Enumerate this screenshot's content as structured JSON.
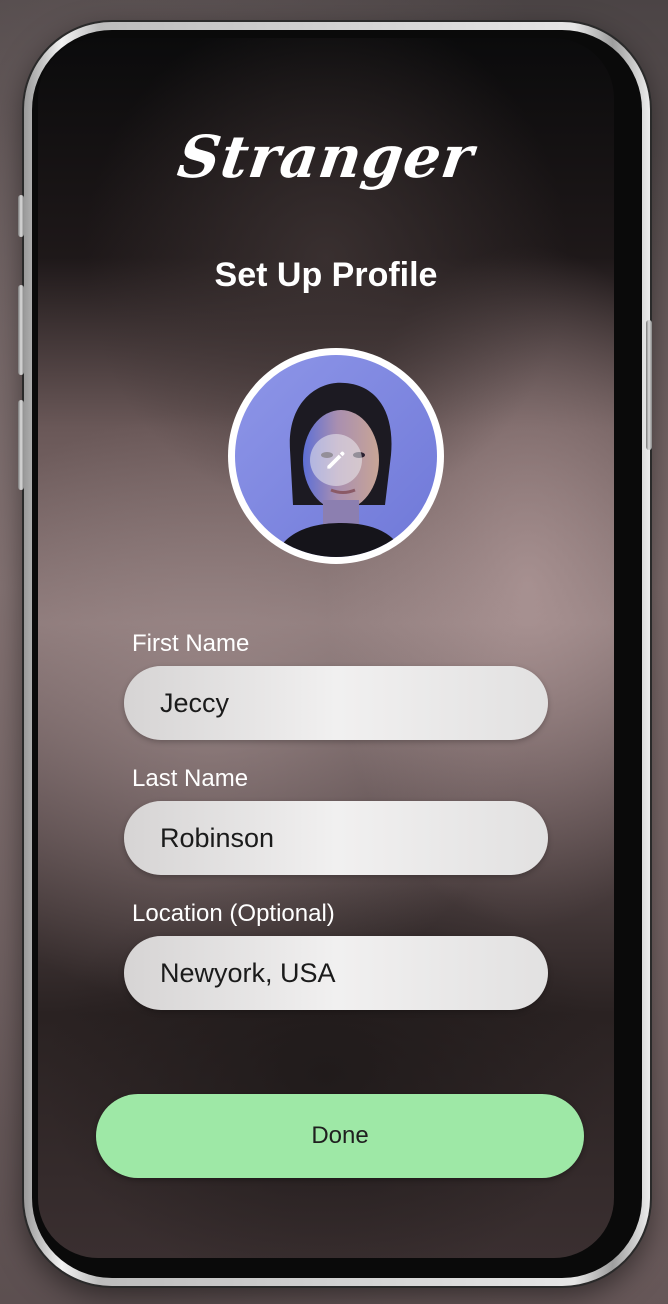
{
  "app": {
    "logo_text": "Stranger",
    "page_title": "Set Up Profile"
  },
  "profile": {
    "avatar_icon": "profile-photo",
    "edit_icon": "pencil-icon"
  },
  "form": {
    "first_name": {
      "label": "First Name",
      "value": "Jeccy"
    },
    "last_name": {
      "label": "Last Name",
      "value": "Robinson"
    },
    "location": {
      "label": "Location (Optional)",
      "value": "Newyork, USA"
    }
  },
  "actions": {
    "done_label": "Done"
  },
  "colors": {
    "accent": "#9ee8a6",
    "field_bg": "#ececec",
    "text_light": "#ffffff"
  }
}
